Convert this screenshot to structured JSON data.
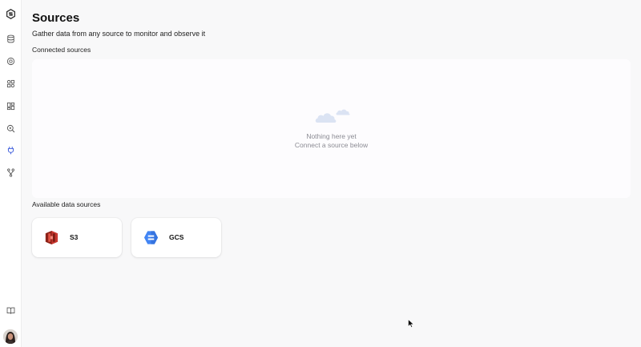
{
  "page": {
    "title": "Sources",
    "subtitle": "Gather data from any source to monitor and observe it"
  },
  "sidebar": {
    "items": [
      {
        "name": "logo-icon"
      },
      {
        "name": "database-icon"
      },
      {
        "name": "target-icon"
      },
      {
        "name": "shapes-icon"
      },
      {
        "name": "dashboard-icon"
      },
      {
        "name": "search-zoom-icon"
      },
      {
        "name": "plug-icon",
        "active": true
      },
      {
        "name": "branch-icon"
      }
    ],
    "bottom": [
      {
        "name": "book-icon"
      },
      {
        "name": "avatar"
      }
    ],
    "active_color": "#3b5bdb"
  },
  "connected": {
    "label": "Connected sources",
    "empty_title": "Nothing here yet",
    "empty_subtitle": "Connect a source below"
  },
  "available": {
    "label": "Available data sources",
    "sources": [
      {
        "name": "S3",
        "icon": "aws-s3-icon",
        "color": "#c7372f"
      },
      {
        "name": "GCS",
        "icon": "google-cloud-storage-icon",
        "color": "#4285f4"
      }
    ]
  }
}
